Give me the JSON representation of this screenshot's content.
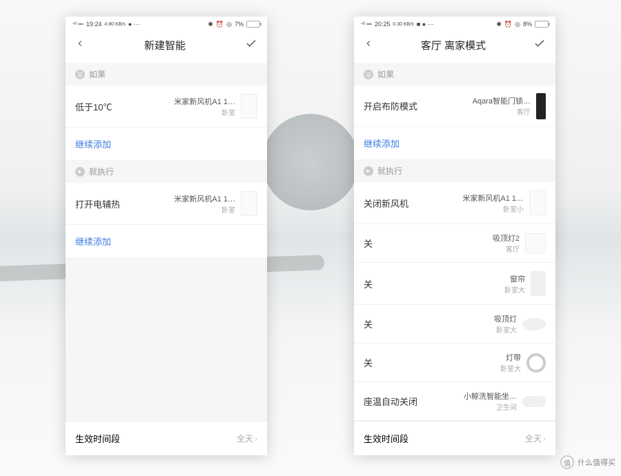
{
  "watermark": "什么值得买",
  "watermark_badge": "值",
  "phone1": {
    "status": {
      "net": "4G",
      "time": "19:24",
      "speed": "4.80 KB/s",
      "battery": "7%"
    },
    "header_title": "新建智能",
    "section_if": "如果",
    "section_then": "就执行",
    "add_more": "继续添加",
    "if_items": [
      {
        "left": "低于10℃",
        "device": "米家新风机A1 1…",
        "room": "卧室",
        "thumb": "tall"
      }
    ],
    "then_items": [
      {
        "left": "打开电辅热",
        "device": "米家新风机A1 1…",
        "room": "卧室",
        "thumb": "tall"
      }
    ],
    "bottom_label": "生效时间段",
    "bottom_value": "全天"
  },
  "phone2": {
    "status": {
      "net": "4G",
      "time": "20:25",
      "speed": "0.30 KB/s",
      "battery": "8%"
    },
    "header_title": "客厅 离家模式",
    "section_if": "如果",
    "section_then": "就执行",
    "add_more": "继续添加",
    "if_items": [
      {
        "left": "开启布防模式",
        "device": "Aqara智能门锁…",
        "room": "客厅",
        "thumb": "lock"
      }
    ],
    "then_items": [
      {
        "left": "关闭新风机",
        "device": "米家新风机A1 1…",
        "room": "卧室小",
        "thumb": "tall"
      },
      {
        "left": "关",
        "device": "吸顶灯2",
        "room": "客厅",
        "thumb": "square"
      },
      {
        "left": "关",
        "device": "窗帘",
        "room": "卧室大",
        "thumb": "curtain"
      },
      {
        "left": "关",
        "device": "吸顶灯",
        "room": "卧室大",
        "thumb": "oval"
      },
      {
        "left": "关",
        "device": "灯带",
        "room": "卧室大",
        "thumb": "ring"
      },
      {
        "left": "座温自动关闭",
        "device": "小鲸洗智能坐…",
        "room": "卫生间",
        "thumb": "toilet"
      }
    ],
    "bottom_label": "生效时间段",
    "bottom_value": "全天"
  }
}
